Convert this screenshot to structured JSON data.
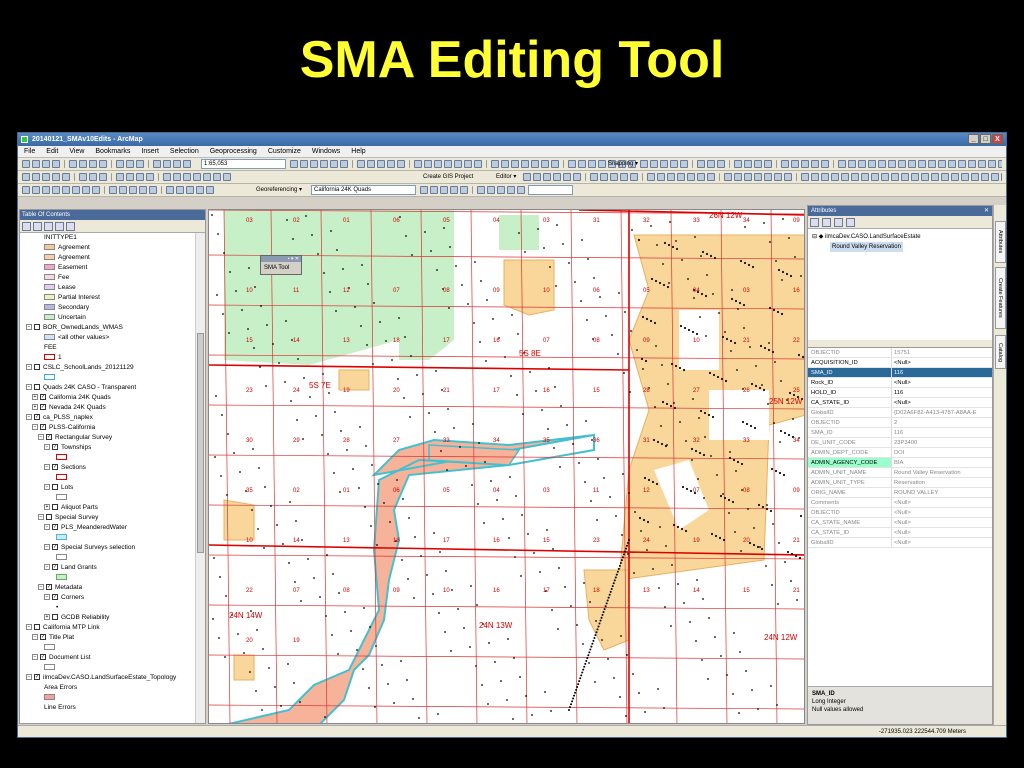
{
  "slide": {
    "title": "SMA Editing Tool"
  },
  "window": {
    "title": "20140121_SMAv10Edits - ArcMap",
    "buttons": [
      "_",
      "□",
      "X"
    ]
  },
  "menu": [
    "File",
    "Edit",
    "View",
    "Bookmarks",
    "Insert",
    "Selection",
    "Geoprocessing",
    "Customize",
    "Windows",
    "Help"
  ],
  "toolbars": {
    "scale": "1:65,053",
    "snapping": "Snapping ▾",
    "create_gis": "Create GIS Project",
    "editor": "Editor ▾",
    "georeferencing": "Georeferencing ▾",
    "georef_layer": "California 24K Quads"
  },
  "toc": {
    "header": "Table Of Contents",
    "items": [
      {
        "text": "INITTYPE1",
        "type": "text",
        "indent": 4
      },
      {
        "text": "Agreement",
        "type": "swatch",
        "color": "#f5c89a",
        "indent": 4
      },
      {
        "text": "Agreement",
        "type": "swatch",
        "color": "#f7cfae",
        "indent": 4
      },
      {
        "text": "Easement",
        "type": "swatch",
        "color": "#f3a8c8",
        "indent": 4
      },
      {
        "text": "Fee",
        "type": "swatch",
        "color": "#f9d6e6",
        "indent": 4
      },
      {
        "text": "Lease",
        "type": "swatch",
        "color": "#e6ccf0",
        "indent": 4
      },
      {
        "text": "Partial Interest",
        "type": "swatch",
        "color": "#e8f4b8",
        "indent": 4
      },
      {
        "text": "Secondary",
        "type": "swatch",
        "color": "#b8b8e8",
        "indent": 4
      },
      {
        "text": "Uncertain",
        "type": "swatch",
        "color": "#c8f0c8",
        "indent": 4
      },
      {
        "text": "BOR_OwnedLands_WMAS",
        "type": "layer",
        "pm": "−",
        "checked": false,
        "indent": 1
      },
      {
        "text": "<all other values>",
        "type": "swatch",
        "color": "#cce6f8",
        "indent": 4
      },
      {
        "text": "FEE",
        "type": "text",
        "indent": 4
      },
      {
        "text": "1",
        "type": "swatch",
        "color": "#ffffff",
        "border": "#d00",
        "indent": 4
      },
      {
        "text": "CSLC_SchoolLands_20121129",
        "type": "layer",
        "pm": "−",
        "checked": false,
        "indent": 1
      },
      {
        "text": "",
        "type": "swatch",
        "color": "#ffffff",
        "border": "#3af",
        "indent": 4
      },
      {
        "text": "Quads 24K CASO - Transparent",
        "type": "layer",
        "pm": "−",
        "checked": false,
        "indent": 1
      },
      {
        "text": "California 24K Quads",
        "type": "layer",
        "pm": "+",
        "checked": true,
        "indent": 2
      },
      {
        "text": "Nevada 24K Quads",
        "type": "layer",
        "pm": "+",
        "checked": true,
        "indent": 2
      },
      {
        "text": "ca_PLSS_naplex",
        "type": "layer",
        "pm": "−",
        "checked": true,
        "indent": 1
      },
      {
        "text": "PLSS-California",
        "type": "layer",
        "pm": "−",
        "checked": true,
        "indent": 2
      },
      {
        "text": "Rectangular Survey",
        "type": "layer",
        "pm": "−",
        "checked": true,
        "indent": 3
      },
      {
        "text": "Townships",
        "type": "layer",
        "pm": "−",
        "checked": true,
        "indent": 4
      },
      {
        "text": "",
        "type": "swatch",
        "color": "#ffffff",
        "border": "#d00",
        "indent": 6
      },
      {
        "text": "Sections",
        "type": "layer",
        "pm": "−",
        "checked": true,
        "indent": 4
      },
      {
        "text": "",
        "type": "swatch",
        "color": "#ffffff",
        "border": "#d00",
        "indent": 6
      },
      {
        "text": "Lots",
        "type": "layer",
        "pm": "−",
        "checked": false,
        "indent": 4
      },
      {
        "text": "",
        "type": "swatch",
        "color": "#ffffff",
        "border": "#888",
        "indent": 6
      },
      {
        "text": "Aliquot Parts",
        "type": "layer",
        "pm": "+",
        "checked": false,
        "indent": 4
      },
      {
        "text": "Special Survey",
        "type": "layer",
        "pm": "−",
        "checked": false,
        "indent": 3
      },
      {
        "text": "PLS_MeanderedWater",
        "type": "layer",
        "pm": "−",
        "checked": true,
        "indent": 4
      },
      {
        "text": "",
        "type": "swatch",
        "color": "#bfeff8",
        "border": "#6ac",
        "indent": 6
      },
      {
        "text": "Special Surveys selection",
        "type": "layer",
        "pm": "−",
        "checked": true,
        "indent": 4
      },
      {
        "text": "",
        "type": "swatch",
        "color": "#ffffff",
        "border": "#888",
        "indent": 6
      },
      {
        "text": "Land Grants",
        "type": "layer",
        "pm": "−",
        "checked": true,
        "indent": 4
      },
      {
        "text": "",
        "type": "swatch",
        "color": "#c8f0c8",
        "border": "#6a6",
        "indent": 6
      },
      {
        "text": "Metadata",
        "type": "layer",
        "pm": "−",
        "checked": true,
        "indent": 3
      },
      {
        "text": "Corners",
        "type": "layer",
        "pm": "−",
        "checked": true,
        "indent": 4
      },
      {
        "text": "•",
        "type": "text",
        "indent": 6
      },
      {
        "text": "GCDB Reliability",
        "type": "layer",
        "pm": "+",
        "checked": false,
        "indent": 4
      },
      {
        "text": "California MTP Link",
        "type": "layer",
        "pm": "−",
        "checked": false,
        "indent": 1
      },
      {
        "text": "Title Plat",
        "type": "layer",
        "pm": "−",
        "checked": true,
        "indent": 2
      },
      {
        "text": "",
        "type": "swatch",
        "color": "#ffffff",
        "border": "#888",
        "indent": 4
      },
      {
        "text": "Document List",
        "type": "layer",
        "pm": "−",
        "checked": true,
        "indent": 2
      },
      {
        "text": "",
        "type": "swatch",
        "color": "#ffffff",
        "border": "#888",
        "indent": 4
      },
      {
        "text": "ilmcaDev.CASO.LandSurfaceEstate_Topology",
        "type": "layer",
        "pm": "−",
        "checked": true,
        "indent": 1
      },
      {
        "text": "Area Errors",
        "type": "text",
        "indent": 4
      },
      {
        "text": "",
        "type": "swatch",
        "color": "#f7a0a0",
        "indent": 4
      },
      {
        "text": "Line Errors",
        "type": "text",
        "indent": 4
      }
    ]
  },
  "sma_tool": {
    "label": "SMA Tool"
  },
  "map": {
    "township_labels": [
      "26N 12W",
      "5S 7E",
      "5S 8E",
      "25N 12W",
      "24N 14W",
      "24N 13W",
      "24N 12W"
    ],
    "section_labels": [
      "03",
      "02",
      "01",
      "06",
      "05",
      "04",
      "03",
      "31",
      "32",
      "33",
      "34",
      "09",
      "10",
      "11",
      "12",
      "07",
      "08",
      "09",
      "10",
      "06",
      "05",
      "04",
      "03",
      "16",
      "15",
      "14",
      "13",
      "18",
      "17",
      "16",
      "07",
      "08",
      "09",
      "10",
      "21",
      "22",
      "23",
      "24",
      "19",
      "20",
      "21",
      "17",
      "16",
      "15",
      "28",
      "27",
      "26",
      "25",
      "30",
      "29",
      "28",
      "27",
      "33",
      "34",
      "35",
      "36",
      "31",
      "32",
      "33",
      "34",
      "35",
      "02",
      "01",
      "06",
      "05",
      "04",
      "03",
      "11",
      "12",
      "07",
      "08",
      "09",
      "10",
      "14",
      "13",
      "18",
      "17",
      "16",
      "15",
      "23",
      "24",
      "19",
      "20",
      "21",
      "22",
      "07",
      "08",
      "09",
      "10",
      "16",
      "17",
      "18",
      "13",
      "14",
      "15",
      "21",
      "20",
      "19"
    ]
  },
  "attributes": {
    "header": "Attributes",
    "tree": {
      "layer": "ilmcaDev.CASO.LandSurfaceEstate",
      "feature": "Round Valley Reservation"
    },
    "rows": [
      {
        "key": "OBJECTID",
        "value": "15751",
        "ro": true
      },
      {
        "key": "ACQUISITION_ID",
        "value": "<Null>",
        "ro": false
      },
      {
        "key": "SMA_ID",
        "value": "116",
        "ro": false,
        "hl": true
      },
      {
        "key": "Rock_ID",
        "value": "<Null>",
        "ro": false
      },
      {
        "key": "HOLD_ID",
        "value": "116",
        "ro": false
      },
      {
        "key": "CA_STATE_ID",
        "value": "<Null>",
        "ro": false
      },
      {
        "key": "GlobalID",
        "value": "{D02A6F82-A413-4787-A8AA-E",
        "ro": true
      },
      {
        "key": "OBJECTID",
        "value": "2",
        "ro": true
      },
      {
        "key": "SMA_ID",
        "value": "116",
        "ro": true
      },
      {
        "key": "DE_UNIT_CODE",
        "value": "23P3400",
        "ro": true
      },
      {
        "key": "ADMIN_DEPT_CODE",
        "value": "DOI",
        "ro": true
      },
      {
        "key": "ADMIN_AGENCY_CODE",
        "value": "BIA",
        "ro": true,
        "hl2": true
      },
      {
        "key": "ADMIN_UNIT_NAME",
        "value": "Round Valley Reservation",
        "ro": true
      },
      {
        "key": "ADMIN_UNIT_TYPE",
        "value": "Reservation",
        "ro": true
      },
      {
        "key": "ORIG_NAME",
        "value": "ROUND VALLEY",
        "ro": true
      },
      {
        "key": "Comments",
        "value": "<Null>",
        "ro": true
      },
      {
        "key": "OBJECTID",
        "value": "<Null>",
        "ro": true
      },
      {
        "key": "CA_STATE_NAME",
        "value": "<Null>",
        "ro": true
      },
      {
        "key": "CA_STATE_ID",
        "value": "<Null>",
        "ro": true
      },
      {
        "key": "GlobalID",
        "value": "<Null>",
        "ro": true
      }
    ],
    "info": {
      "field": "SMA_ID",
      "type": "Long Integer",
      "nulls": "Null values allowed"
    }
  },
  "side_tabs": [
    "Attributes",
    "Create Features",
    "Catalog"
  ],
  "status": {
    "coords": "-271935.023  222544.709 Meters"
  }
}
